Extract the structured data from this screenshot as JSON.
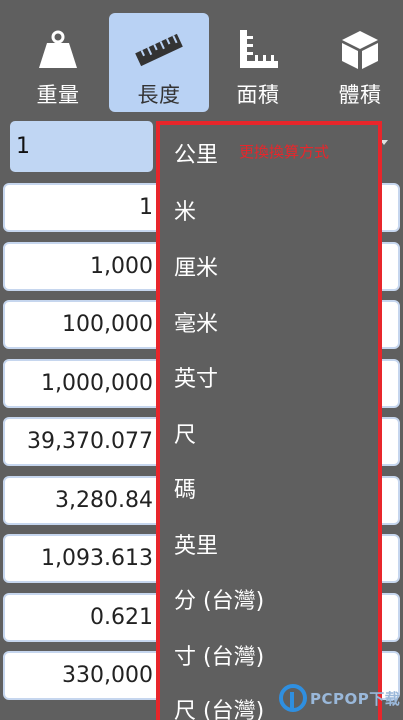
{
  "tabs": [
    {
      "label": "重量",
      "icon": "weight-icon"
    },
    {
      "label": "長度",
      "icon": "ruler-icon"
    },
    {
      "label": "面積",
      "icon": "area-icon"
    },
    {
      "label": "體積",
      "icon": "cube-icon"
    }
  ],
  "active_tab": "長度",
  "input": {
    "value": "1"
  },
  "rows": [
    "1",
    "1,000",
    "100,000",
    "1,000,000",
    "39,370.077",
    "3,280.84",
    "1,093.613",
    "0.621",
    "330,000"
  ],
  "dropdown": {
    "items": [
      "公里",
      "米",
      "厘米",
      "毫米",
      "英寸",
      "尺",
      "碼",
      "英里",
      "分 (台灣)",
      "寸 (台灣)",
      "尺 (台灣)"
    ],
    "annotation": "更換換算方式"
  },
  "watermark": {
    "text": "PCPOP下载"
  },
  "colors": {
    "accent_red": "#e8262b",
    "active_tab": "#b9d2f4",
    "background": "#5f5f5f"
  }
}
